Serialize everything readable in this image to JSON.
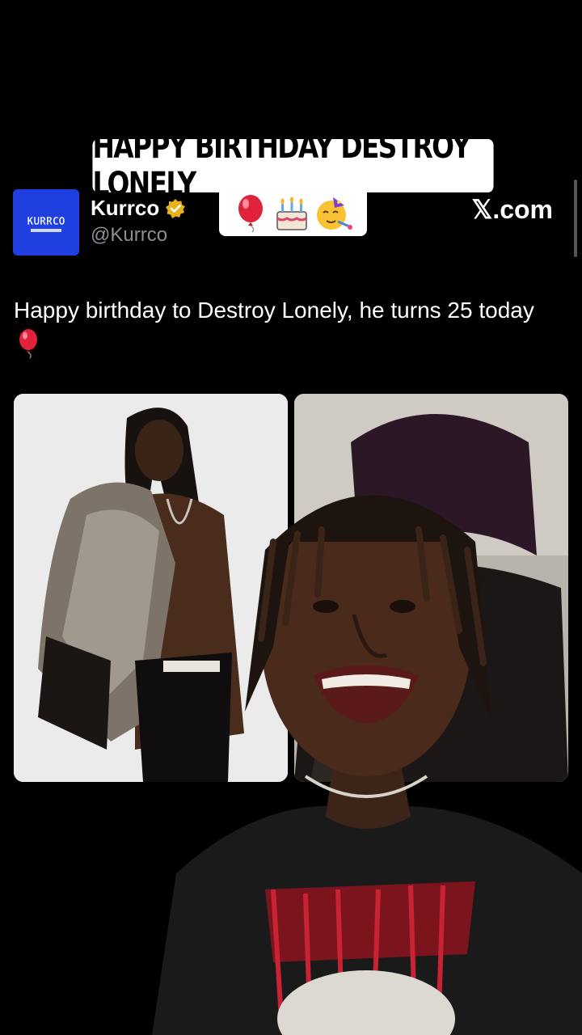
{
  "caption": {
    "title": "HAPPY BIRTHDAY DESTROY LONELY",
    "emojis": [
      "balloon",
      "birthday-cake",
      "partying-face"
    ]
  },
  "tweet": {
    "author_name": "Kurrco",
    "handle": "@Kurrco",
    "site": "𝕏.com",
    "text": "Happy birthday to Destroy Lonely, he turns 25 today",
    "text_emoji": "balloon",
    "avatar_text": "KURRCO"
  },
  "colors": {
    "background": "#000000",
    "text": "#ffffff",
    "handle": "#8b8f94",
    "avatar": "#1f3fe0",
    "verified_badge": "#e8b21a"
  }
}
